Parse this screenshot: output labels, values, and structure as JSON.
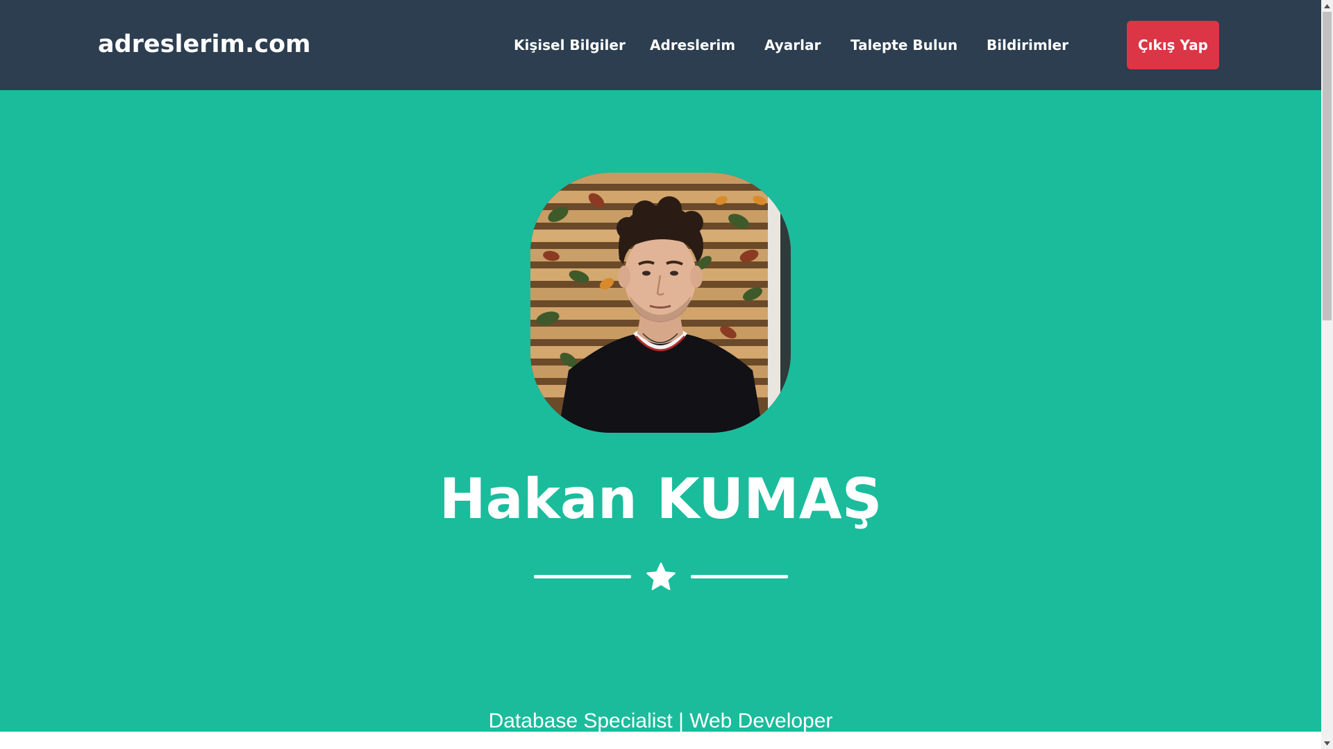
{
  "navbar": {
    "brand": "adreslerim.com",
    "links": [
      {
        "label": "Kişisel Bilgiler"
      },
      {
        "label": "Adreslerim"
      },
      {
        "label": "Ayarlar"
      },
      {
        "label": "Talepte Bulun"
      },
      {
        "label": "Bildirimler"
      }
    ],
    "logout_label": "Çıkış Yap"
  },
  "hero": {
    "name": "Hakan KUMAŞ",
    "subtitle": "Database Specialist | Web Developer",
    "divider_icon": "star-icon"
  },
  "colors": {
    "navbar_bg": "#2c3e50",
    "hero_bg": "#1abc9c",
    "logout_bg": "#dc3545",
    "text": "#ffffff"
  }
}
